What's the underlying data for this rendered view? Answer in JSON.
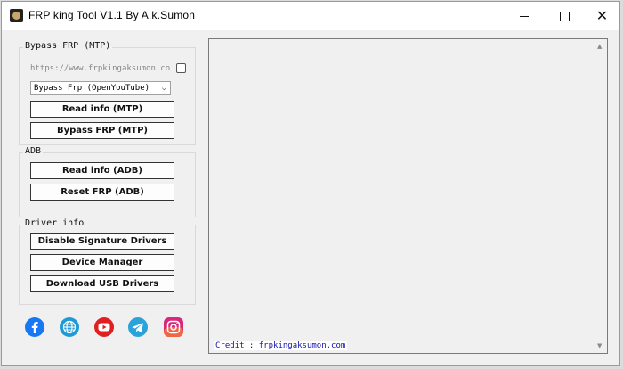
{
  "window": {
    "title": "FRP king Tool V1.1 By A.k.Sumon",
    "controls": {
      "minimize_icon": "minimize-icon",
      "maximize_icon": "maximize-icon",
      "close_glyph": "✕"
    }
  },
  "bypass_frp": {
    "label": "Bypass FRP (MTP)",
    "url_value": "https://www.frpkingaksumon.co",
    "checkbox_checked": false,
    "mode_select": {
      "selected": "Bypass Frp (OpenYouTube)",
      "chevron": "⌵"
    },
    "read_info_label": "Read info (MTP)",
    "bypass_label": "Bypass FRP (MTP)"
  },
  "adb": {
    "label": "ADB",
    "read_info_label": "Read info (ADB)",
    "reset_label": "Reset FRP (ADB)"
  },
  "driver_info": {
    "label": "Driver info",
    "disable_sig_label": "Disable Signature Drivers",
    "device_manager_label": "Device Manager",
    "download_usb_label": "Download USB Drivers"
  },
  "social_links": [
    {
      "name": "facebook-icon",
      "color": "#1877f2"
    },
    {
      "name": "website-globe-icon",
      "color": "#1e9bd7"
    },
    {
      "name": "youtube-icon",
      "color": "#e02020"
    },
    {
      "name": "telegram-icon",
      "color": "#2aa3da"
    },
    {
      "name": "instagram-icon",
      "color": "#d6297c"
    }
  ],
  "log": {
    "credit_text": "Credit : frpkingaksumon.com",
    "credit_color": "#1414a8",
    "scroll_up": "▲",
    "scroll_down": "▼"
  }
}
